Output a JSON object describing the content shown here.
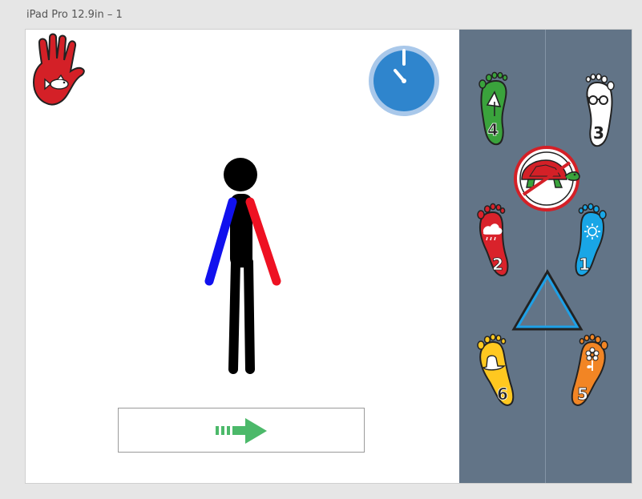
{
  "artboard": {
    "title": "iPad Pro 12.9in – 1"
  },
  "foot_buttons": [
    {
      "number": "1",
      "color": "#19a6e6",
      "icon": "sun-icon"
    },
    {
      "number": "2",
      "color": "#d9222b",
      "icon": "cloud-rain-icon"
    },
    {
      "number": "3",
      "color": "#ffffff",
      "icon": "glasses-icon"
    },
    {
      "number": "4",
      "color": "#3aa33c",
      "icon": "umbrella-icon"
    },
    {
      "number": "5",
      "color": "#f28524",
      "icon": "flower-icon"
    },
    {
      "number": "6",
      "color": "#ffc820",
      "icon": "hat-icon"
    }
  ],
  "colors": {
    "timer": "#2f85cd",
    "hand": "#d42027",
    "left_arm": "#1111ee",
    "right_arm": "#ee1122",
    "arrow": "#4cb96a",
    "triangle": "#1ea0e6",
    "panel": "#627487"
  },
  "icons": {
    "hand": "hand-fish-icon",
    "timer": "timer-icon",
    "turtle": "turtle-icon",
    "triangle": "triangle-icon",
    "arrow": "arrow-right-icon"
  }
}
